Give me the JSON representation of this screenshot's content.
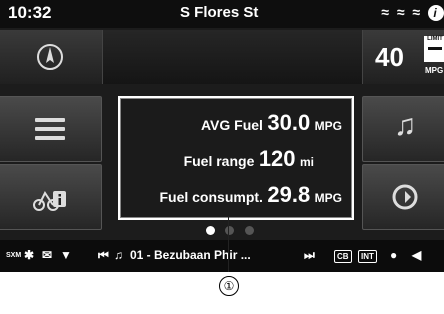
{
  "status_bar": {
    "time": "10:32",
    "street": "S Flores St",
    "icons": [
      "signal-icon-1",
      "signal-icon-2",
      "signal-icon-3",
      "info-icon"
    ]
  },
  "speed": {
    "value": "40",
    "limit_label": "LIMIT",
    "unit": "MPG"
  },
  "fuel_panel": {
    "rows": [
      {
        "label": "AVG Fuel",
        "value": "30.0",
        "unit": "MPG"
      },
      {
        "label": "Fuel range",
        "value": "120",
        "unit": "mi"
      },
      {
        "label": "Fuel consumpt.",
        "value": "29.8",
        "unit": "MPG"
      }
    ],
    "page_indicator": {
      "total": 3,
      "active": 1
    }
  },
  "bottom_bar": {
    "sxm_label": "SXM",
    "track": "01 - Bezubaan Phir ...",
    "cb_label": "CB",
    "int_label": "INT"
  },
  "callout": {
    "number": "①"
  }
}
